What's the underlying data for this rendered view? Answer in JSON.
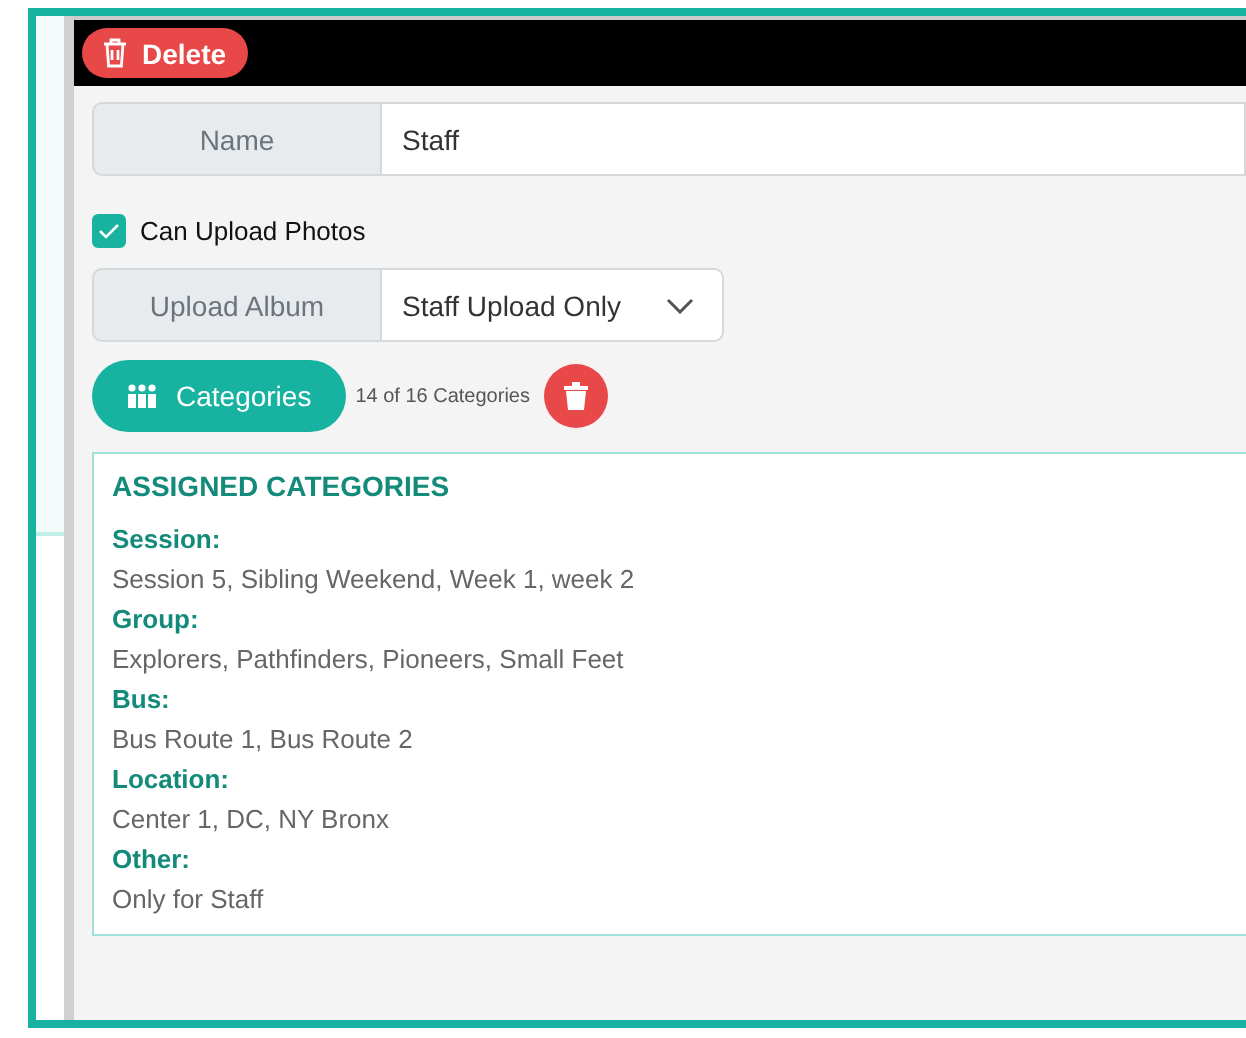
{
  "header": {
    "delete_button": "Delete"
  },
  "form": {
    "name": {
      "label": "Name",
      "value": "Staff"
    },
    "can_upload_photos": {
      "label": "Can Upload Photos",
      "checked": true
    },
    "upload_album": {
      "label": "Upload Album",
      "value": "Staff Upload Only"
    },
    "categories_button": "Categories",
    "categories_count": "14 of 16 Categories"
  },
  "assigned": {
    "title": "ASSIGNED CATEGORIES",
    "groups": [
      {
        "label": "Session:",
        "value": "Session 5, Sibling Weekend, Week 1, week 2"
      },
      {
        "label": "Group:",
        "value": "Explorers, Pathfinders, Pioneers, Small Feet"
      },
      {
        "label": "Bus:",
        "value": "Bus Route 1, Bus Route 2"
      },
      {
        "label": "Location:",
        "value": "Center 1, DC, NY Bronx"
      },
      {
        "label": "Other:",
        "value": "Only for Staff"
      }
    ]
  }
}
